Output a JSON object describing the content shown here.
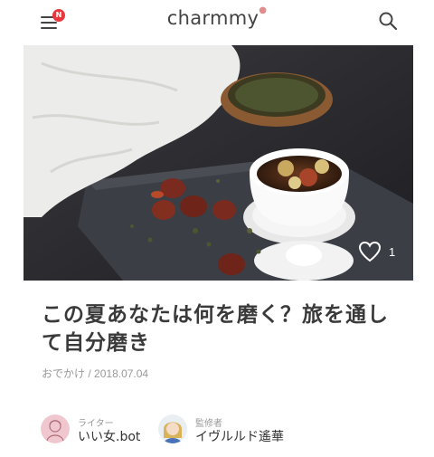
{
  "header": {
    "logo_text": "charmmy",
    "menu_badge": "N",
    "menu_icon": "hamburger-icon",
    "search_icon": "search-icon"
  },
  "hero": {
    "like_count": "1",
    "like_icon": "heart-outline-icon"
  },
  "article": {
    "title_line1": "この夏あなたは何を磨く？旅を通し",
    "title_line2": "て自分磨き",
    "category": "おでかけ",
    "separator": "/",
    "date": "2018.07.04"
  },
  "authors": [
    {
      "role": "ライター",
      "name": "いい女.bot"
    },
    {
      "role": "監修者",
      "name": "イヴルルド遙華"
    }
  ],
  "colors": {
    "accent": "#e8383d",
    "logo_dot": "#e58b8b"
  }
}
